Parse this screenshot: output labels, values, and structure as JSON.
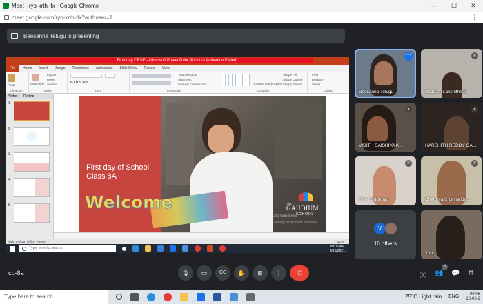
{
  "browser": {
    "tab_title": "Meet - ryb-xrth-ifx - Google Chrome",
    "url": "meet.google.com/ryb-xrth-ifx?authuser=1",
    "window_controls": [
      "—",
      "☐",
      "✕"
    ],
    "menu_icon": "⋮"
  },
  "meet": {
    "presenting_text": "Beesanna Telugu is presenting",
    "meeting_code": "cb-8a",
    "participants_badge": "18",
    "controls": [
      "mic",
      "camera",
      "captions",
      "raise-hand",
      "present",
      "more",
      "end-call"
    ],
    "control_glyphs": {
      "mic": "🎙",
      "camera": "▭",
      "captions": "CC",
      "raise-hand": "✋",
      "present": "⊞",
      "more": "⋮",
      "end": "✆",
      "info": "ⓘ",
      "people": "👥",
      "chat": "💬",
      "activities": "⚙"
    }
  },
  "shared_screen": {
    "ppt_window_title": "First day CBSE - Microsoft PowerPoint (Product Activation Failed)",
    "ribbon_tabs": [
      "File",
      "Home",
      "Insert",
      "Design",
      "Transitions",
      "Animations",
      "Slide Show",
      "Review",
      "View"
    ],
    "ribbon_groups": [
      "Clipboard",
      "Slides",
      "Font",
      "Paragraph",
      "Drawing",
      "Editing"
    ],
    "ribbon_text": {
      "paste": "Paste",
      "new_slide": "New Slide",
      "layout": "Layout",
      "reset": "Reset",
      "section": "Section",
      "text_direction": "Text Direction",
      "align_text": "Align Text",
      "convert_smartart": "Convert to SmartArt",
      "arrange": "Arrange",
      "quick_styles": "Quick Styles",
      "shape_fill": "Shape Fill",
      "shape_outline": "Shape Outline",
      "shape_effects": "Shape Effects",
      "find": "Find",
      "replace": "Replace",
      "select": "Select"
    },
    "pane_tabs": [
      "Slides",
      "Outline"
    ],
    "slide_numbers": [
      "1",
      "2",
      "3",
      "4",
      "5"
    ],
    "slide": {
      "title_line1": "First day of School",
      "title_line2": "Class 8A",
      "welcome": "Welcome",
      "logo_the": "THE",
      "logo_name": "GAUDIUM",
      "logo_school": "SCHOOL",
      "activate_line1": "Activate Windows",
      "activate_line2": "Go to Settings to activate Windows."
    },
    "status_left": "Slide 1 of 16   \"Office Theme\"",
    "zoom": "61%",
    "inner_taskbar_search": "Type here to search",
    "inner_clock_time": "09:06 AM",
    "inner_clock_date": "6/16/2021"
  },
  "tiles": [
    {
      "name": "Beesanna Telugu",
      "active": true
    },
    {
      "name": "Baddam Lakshitha R..."
    },
    {
      "name": "VIDITH SAISHIVA K..."
    },
    {
      "name": "HARSHITH REDDY GA..."
    },
    {
      "name": "Tanvi Uddaraju"
    },
    {
      "name": "Chaturya Krishna Da..."
    },
    {
      "name": "10 others",
      "avatar_letter": "V"
    },
    {
      "name": "You"
    }
  ],
  "os": {
    "search": "Type here to search",
    "weather": "25°C  Light rain",
    "lang": "ENG",
    "time": "09:06",
    "date": "16-06-2"
  },
  "colors": {
    "meet_bg": "#202124",
    "tile_bg": "#3c4043",
    "end_call": "#ea4335",
    "ppt_accent": "#c43e1c",
    "slide_red": "#c6463f",
    "active_outline": "#8ab4f8"
  }
}
